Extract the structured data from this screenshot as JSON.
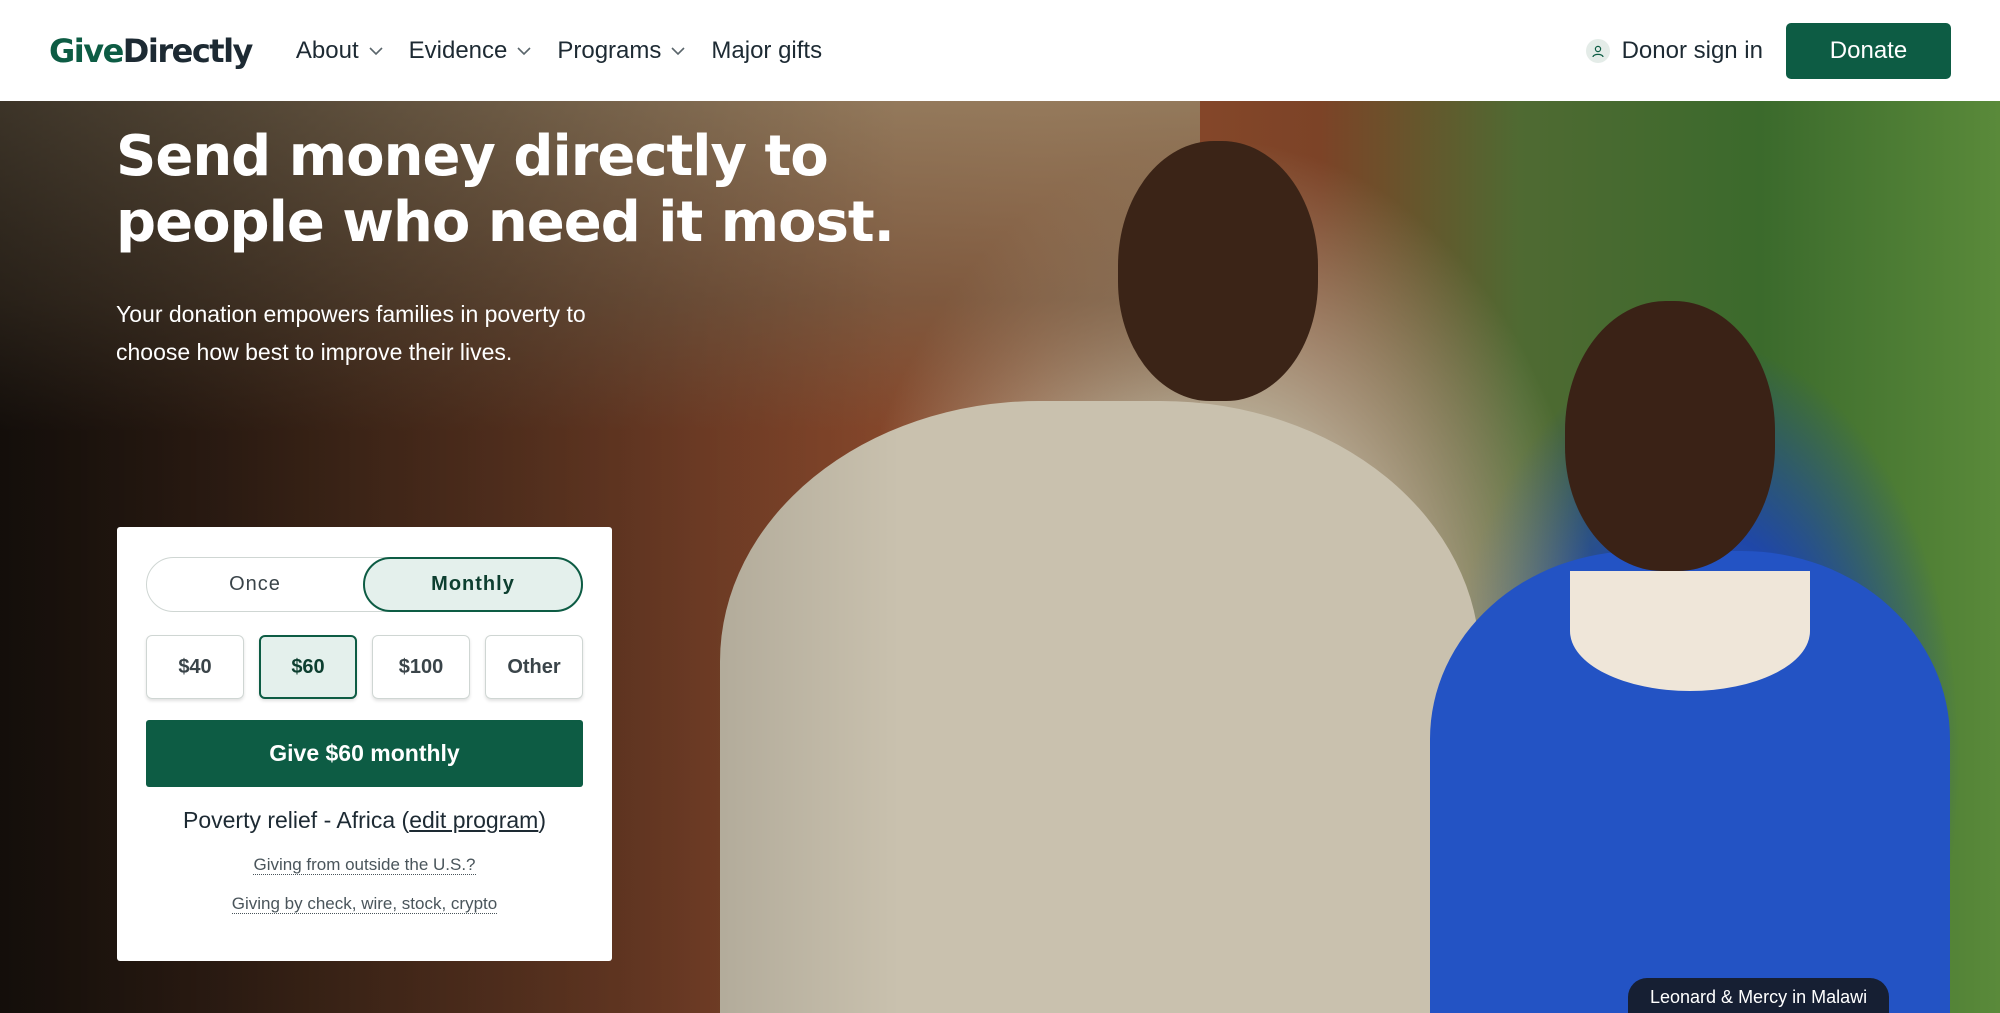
{
  "header": {
    "logo": {
      "part1": "Give",
      "part2": "Directly"
    },
    "nav": [
      {
        "label": "About",
        "has_dropdown": true
      },
      {
        "label": "Evidence",
        "has_dropdown": true
      },
      {
        "label": "Programs",
        "has_dropdown": true
      },
      {
        "label": "Major gifts",
        "has_dropdown": false
      }
    ],
    "signin_label": "Donor sign in",
    "donate_label": "Donate"
  },
  "hero": {
    "headline": "Send money directly to people who need it most.",
    "subline": "Your donation empowers families in poverty to choose how best to improve their lives.",
    "caption": "Leonard & Mercy in Malawi"
  },
  "donation": {
    "frequency": {
      "options": [
        "Once",
        "Monthly"
      ],
      "selected": "Monthly"
    },
    "amounts": [
      "$40",
      "$60",
      "$100",
      "Other"
    ],
    "selected_amount": "$60",
    "give_button": "Give $60 monthly",
    "program": {
      "prefix": "Poverty relief - Africa (",
      "edit_label": "edit program",
      "suffix": ")"
    },
    "links": [
      "Giving from outside the U.S.?",
      "Giving by check, wire, stock, crypto"
    ]
  },
  "colors": {
    "brand": "#0d5c44",
    "brand_light": "#e4f0ec",
    "text": "#1d2a33"
  }
}
